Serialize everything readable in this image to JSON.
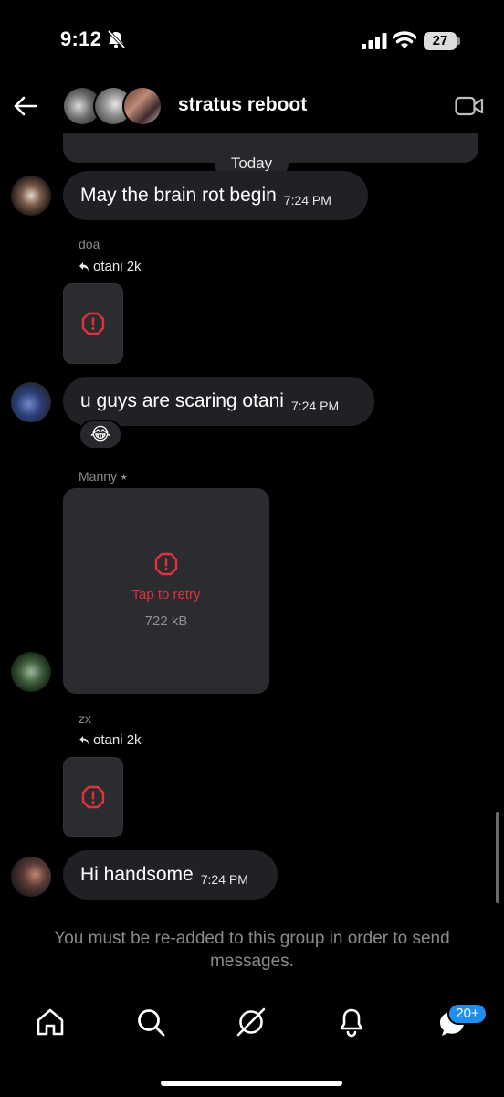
{
  "status_bar": {
    "time": "9:12",
    "battery": "27"
  },
  "header": {
    "group_name": "stratus reboot"
  },
  "date_divider": "Today",
  "messages": [
    {
      "text": "May the brain rot begin",
      "time": "7:24 PM"
    },
    {
      "sender": "doa",
      "reply_to": "otani 2k"
    },
    {
      "text": "u guys are scaring otani",
      "time": "7:24 PM",
      "reaction": "😂"
    },
    {
      "sender": "Manny ⭑",
      "retry_label": "Tap to retry",
      "file_size": "722 kB"
    },
    {
      "sender": "zx",
      "reply_to": "otani 2k"
    },
    {
      "text": "Hi handsome",
      "time": "7:24 PM"
    }
  ],
  "notice": "You must be re-added to this group in order to send messages.",
  "nav": {
    "badge": "20+"
  },
  "colors": {
    "background": "#000000",
    "bubble": "#1f2124",
    "error": "#e0323a",
    "badge": "#1e8fee"
  }
}
